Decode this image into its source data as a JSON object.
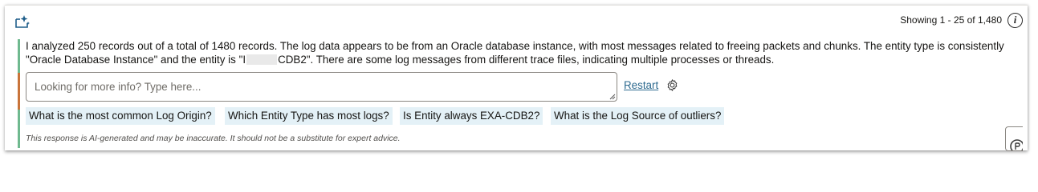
{
  "header": {
    "ai_icon": "ai-assistant-icon",
    "showing": "Showing 1 - 25 of 1,480",
    "info_icon": "info-icon",
    "info_glyph": "i"
  },
  "summary": {
    "before_redaction": "I analyzed 250 records out of a total of 1480 records. The log data appears to be from an Oracle database instance, with most messages related to freeing packets and chunks. The entity type is consistently \"Oracle Database Instance\" and the entity is \"",
    "redacted_prefix": "I",
    "after_redaction": "CDB2\". There are some log messages from different trace files, indicating multiple processes or threads."
  },
  "input": {
    "placeholder": "Looking for more info? Type here..."
  },
  "actions": {
    "restart_label": "Restart",
    "settings_icon": "gear-icon"
  },
  "suggestions": [
    "What is the most common Log Origin?",
    "Which Entity Type has most logs?",
    "Is Entity always EXA-CDB2?",
    "What is the Log Source of outliers?"
  ],
  "disclaimer": "This response is AI-generated and may be inaccurate. It should not be a substitute for expert advice.",
  "colors": {
    "accent_link": "#2d6a8f",
    "chip_bg": "#e4f1f7",
    "rule_green": "#6fb98f",
    "rule_orange": "#c9743a"
  }
}
